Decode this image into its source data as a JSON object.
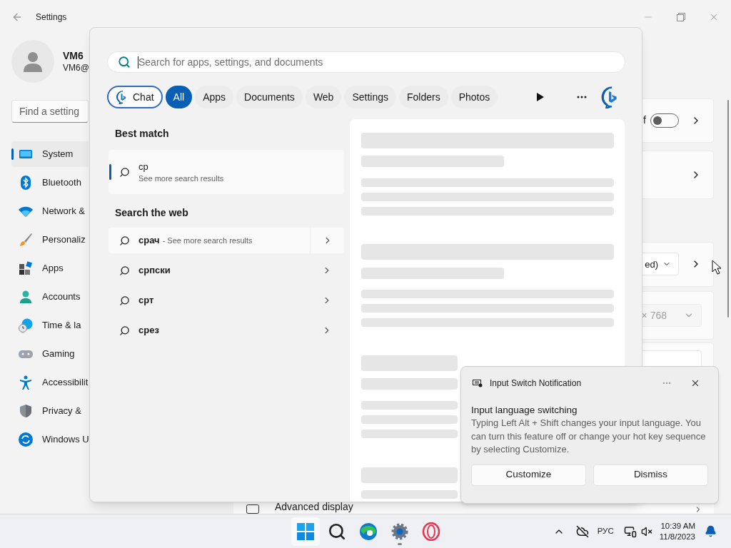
{
  "settings": {
    "title": "Settings",
    "user": {
      "name": "VM6",
      "email": "VM6@"
    },
    "search": {
      "placeholder": "Find a setting"
    },
    "nav": [
      {
        "label": "System",
        "selected": true
      },
      {
        "label": "Bluetooth",
        "selected": false
      },
      {
        "label": "Network &",
        "selected": false
      },
      {
        "label": "Personaliz",
        "selected": false
      },
      {
        "label": "Apps",
        "selected": false
      },
      {
        "label": "Accounts",
        "selected": false
      },
      {
        "label": "Time & la",
        "selected": false
      },
      {
        "label": "Gaming",
        "selected": false
      },
      {
        "label": "Accessibilit",
        "selected": false
      },
      {
        "label": "Privacy &",
        "selected": false
      },
      {
        "label": "Windows U",
        "selected": false
      }
    ],
    "content": {
      "toggle_label": "f",
      "toggle": {
        "on": false
      },
      "display_mode": "ed)",
      "resolution": {
        "value": "× 768",
        "disabled": true
      },
      "advanced": "Advanced display"
    }
  },
  "search_flyout": {
    "placeholder": "Search for apps, settings, and documents",
    "filters": [
      {
        "label": "Chat",
        "kind": "chat",
        "selected": false
      },
      {
        "label": "All",
        "kind": "filter",
        "selected": true
      },
      {
        "label": "Apps",
        "kind": "filter",
        "selected": false
      },
      {
        "label": "Documents",
        "kind": "filter",
        "selected": false
      },
      {
        "label": "Web",
        "kind": "filter",
        "selected": false
      },
      {
        "label": "Settings",
        "kind": "filter",
        "selected": false
      },
      {
        "label": "Folders",
        "kind": "filter",
        "selected": false
      },
      {
        "label": "Photos",
        "kind": "filter",
        "selected": false
      }
    ],
    "best_match": {
      "heading": "Best match",
      "title": "ср",
      "subtitle": "See more search results"
    },
    "web": {
      "heading": "Search the web",
      "items": [
        {
          "text": "срач",
          "suffix": "- See more search results",
          "selected": true
        },
        {
          "text": "српски",
          "selected": false
        },
        {
          "text": "срт",
          "selected": false
        },
        {
          "text": "срез",
          "selected": false
        }
      ]
    }
  },
  "notification": {
    "app": "Input Switch Notification",
    "title": "Input language switching",
    "body": "Typing Left Alt + Shift changes your input language. You can turn this feature off or change your hot key sequence by selecting Customize.",
    "buttons": [
      "Customize",
      "Dismiss"
    ]
  },
  "taskbar": {
    "apps": [
      {
        "kind": "start",
        "running": false
      },
      {
        "kind": "search",
        "running": false
      },
      {
        "kind": "edge",
        "running": false
      },
      {
        "kind": "settings",
        "running": true
      },
      {
        "kind": "opera",
        "running": false
      }
    ],
    "language": "РУС",
    "time": "10:39 AM",
    "date": "11/8/2023"
  }
}
